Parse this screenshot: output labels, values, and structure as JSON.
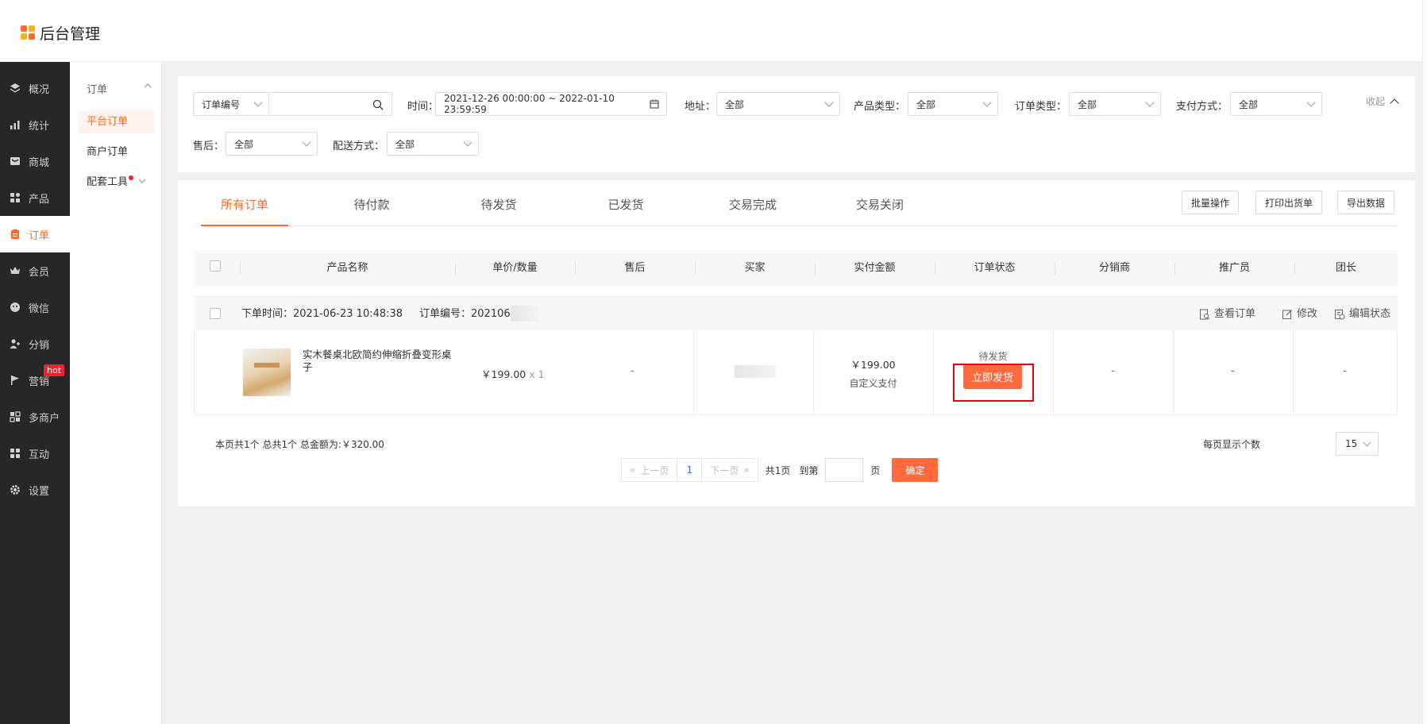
{
  "app": {
    "title": "后台管理"
  },
  "sidebar": {
    "items": [
      {
        "label": "概况",
        "icon": "layers-icon"
      },
      {
        "label": "统计",
        "icon": "chart-icon"
      },
      {
        "label": "商城",
        "icon": "store-icon"
      },
      {
        "label": "产品",
        "icon": "grid-icon"
      },
      {
        "label": "订单",
        "icon": "clipboard-icon",
        "active": true
      },
      {
        "label": "会员",
        "icon": "crown-icon"
      },
      {
        "label": "微信",
        "icon": "wechat-icon"
      },
      {
        "label": "分销",
        "icon": "users-icon"
      },
      {
        "label": "营销",
        "icon": "flag-icon",
        "badge": "hot"
      },
      {
        "label": "多商户",
        "icon": "shop-icon"
      },
      {
        "label": "互动",
        "icon": "apps-icon"
      },
      {
        "label": "设置",
        "icon": "gear-icon"
      }
    ]
  },
  "subsidebar": {
    "group": "订单",
    "items": [
      "平台订单",
      "商户订单",
      "配套工具"
    ]
  },
  "filters": {
    "order_no_select": "订单编号",
    "search_value": "",
    "time_label": "时间：",
    "time_value": "2021-12-26 00:00:00 ~ 2022-01-10 23:59:59",
    "address_label": "地址：",
    "address_value": "全部",
    "product_type_label": "产品类型：",
    "product_type_value": "全部",
    "order_type_label": "订单类型：",
    "order_type_value": "全部",
    "payment_label": "支付方式：",
    "payment_value": "全部",
    "after_sale_label": "售后：",
    "after_sale_value": "全部",
    "delivery_label": "配送方式：",
    "delivery_value": "全部",
    "collapse_label": "收起"
  },
  "tabs": [
    "所有订单",
    "待付款",
    "待发货",
    "已发货",
    "交易完成",
    "交易关闭"
  ],
  "actions": {
    "batch": "批量操作",
    "print": "打印出货单",
    "export": "导出数据"
  },
  "columns": [
    "产品名称",
    "单价/数量",
    "售后",
    "买家",
    "实付金额",
    "订单状态",
    "分销商",
    "推广员",
    "团长"
  ],
  "order": {
    "time_text": "下单时间：2021-06-23 10:48:38",
    "no_text": "订单编号：202106",
    "view": "查看订单",
    "edit": "修改",
    "edit_status": "编辑状态",
    "product_name": "实木餐桌北欧简约伸缩折叠变形桌子",
    "price": "￥199.00",
    "qty": "x 1",
    "after_sale": "-",
    "paid": "￥199.00",
    "pay_method": "自定义支付",
    "status": "待发货",
    "ship_button": "立即发货",
    "distributor": "-",
    "promoter": "-",
    "leader": "-"
  },
  "summary": {
    "text": "本页共1个  总共1个  总金额为:￥320.00"
  },
  "pager": {
    "prev": "上一页",
    "page": "1",
    "next": "下一页",
    "total": "共1页",
    "goto": "到第",
    "unit": "页",
    "ok": "确定",
    "per_page_label": "每页显示个数",
    "per_page": "15"
  }
}
